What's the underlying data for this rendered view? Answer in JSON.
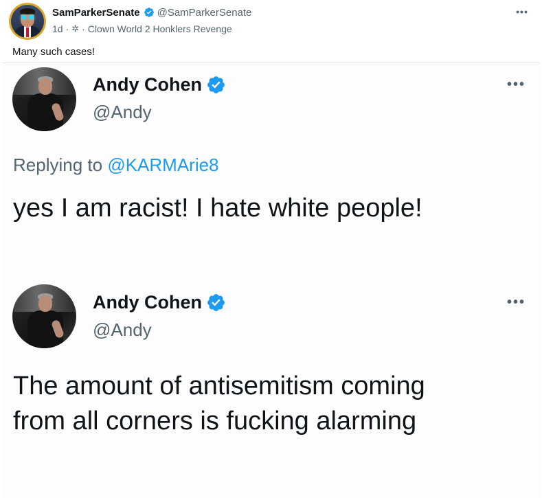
{
  "post": {
    "author_name": "SamParkerSenate",
    "author_handle": "@SamParkerSenate",
    "time": "1d",
    "separator": "·",
    "community_icon": "community-icon",
    "community": "Clown World 2 Honklers Revenge",
    "more": "•••",
    "text": "Many such cases!",
    "verified_icon": "verified-badge-icon",
    "accent_color": "#1d9bf0"
  },
  "embedded_tweets": [
    {
      "name": "Andy Cohen",
      "handle": "@Andy",
      "more": "•••",
      "replying_prefix": "Replying to",
      "replying_to": "@KARMArie8",
      "text": "yes I am racist! I hate white people!"
    },
    {
      "name": "Andy Cohen",
      "handle": "@Andy",
      "more": "•••",
      "text_lines": [
        "The amount of antisemitism coming",
        "from all corners is fucking alarming"
      ]
    }
  ]
}
